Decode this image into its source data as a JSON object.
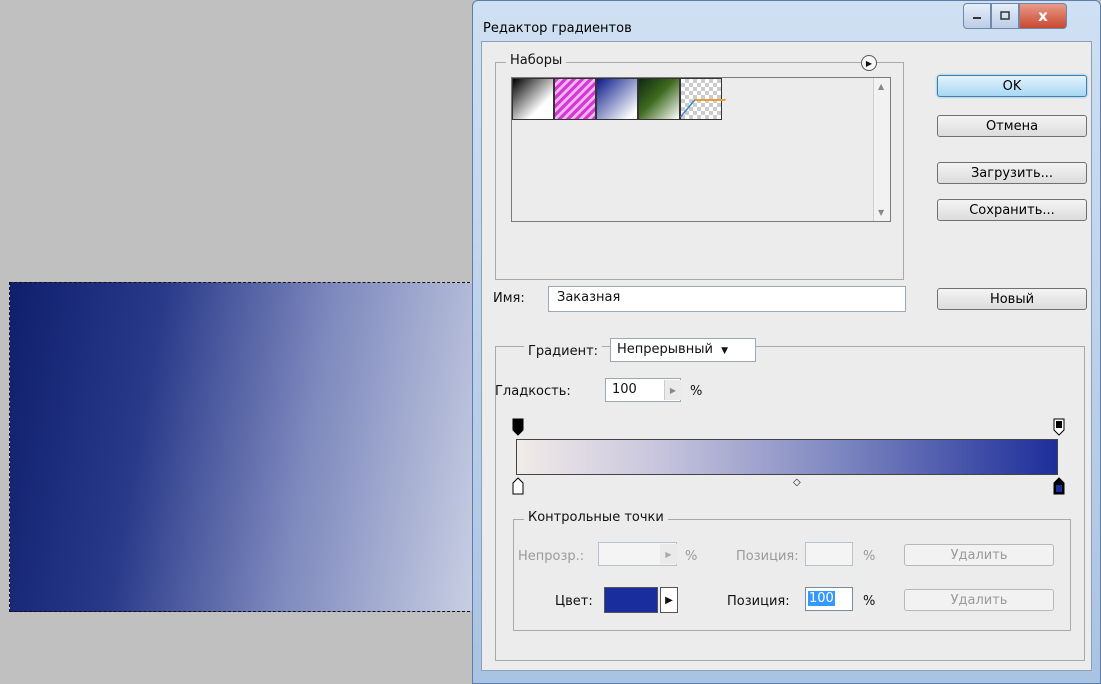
{
  "dialog": {
    "title": "Редактор градиентов",
    "close_symbol": "x"
  },
  "presets": {
    "legend": "Наборы",
    "menu_icon": "play-circle-icon",
    "swatches": [
      "black-white",
      "magenta-stripes",
      "blue-white",
      "green-white",
      "transparent-stripes"
    ]
  },
  "buttons": {
    "ok": "OK",
    "cancel": "Отмена",
    "load": "Загрузить...",
    "save": "Сохранить...",
    "new": "Новый"
  },
  "name": {
    "label": "Имя:",
    "value": "Заказная"
  },
  "gradient": {
    "type_label": "Градиент:",
    "type_value": "Непрерывный",
    "smoothness_label": "Гладкость:",
    "smoothness_value": "100",
    "smoothness_unit": "%",
    "start_color": "#f1ebe8",
    "end_color": "#1e2e9a"
  },
  "stops": {
    "legend": "Контрольные точки",
    "opacity_label": "Непрозр.:",
    "opacity_unit": "%",
    "opacity_position_label": "Позиция:",
    "opacity_position_unit": "%",
    "opacity_delete": "Удалить",
    "color_label": "Цвет:",
    "color_value": "#1a2d9c",
    "color_position_label": "Позиция:",
    "color_position_value": "100",
    "color_position_unit": "%",
    "color_delete": "Удалить"
  },
  "canvas": {
    "selection_gradient_from": "#0f1f6e",
    "selection_gradient_to": "#c9cfe3"
  }
}
